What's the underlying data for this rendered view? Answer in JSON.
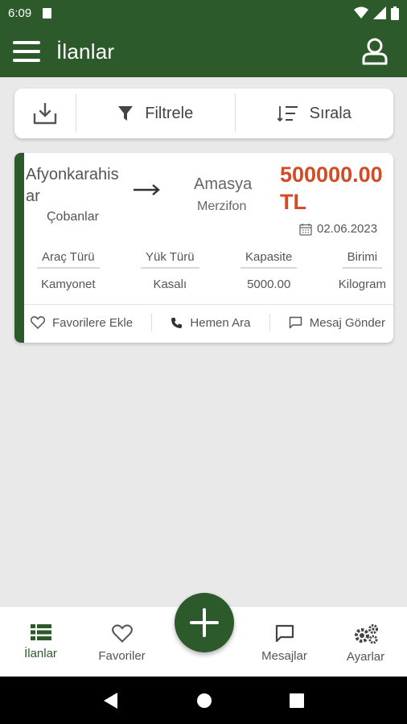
{
  "status_bar": {
    "time": "6:09"
  },
  "app_bar": {
    "title": "İlanlar"
  },
  "toolbar": {
    "filter_label": "Filtrele",
    "sort_label": "Sırala"
  },
  "listing": {
    "origin_city": "Afyonkarahisar",
    "origin_district": "Çobanlar",
    "destination_city": "Amasya",
    "destination_district": "Merzifon",
    "price": "500000.00 TL",
    "date": "02.06.2023",
    "specs": [
      {
        "label": "Araç Türü",
        "value": "Kamyonet"
      },
      {
        "label": "Yük Türü",
        "value": "Kasalı"
      },
      {
        "label": "Kapasite",
        "value": "5000.00"
      },
      {
        "label": "Birimi",
        "value": "Kilogram"
      }
    ],
    "actions": {
      "favorite": "Favorilere Ekle",
      "call": "Hemen Ara",
      "message": "Mesaj Gönder"
    }
  },
  "bottom_nav": {
    "listings": "İlanlar",
    "favorites": "Favoriler",
    "messages": "Mesajlar",
    "settings": "Ayarlar"
  },
  "colors": {
    "primary": "#2d5a2b",
    "price": "#d34a24",
    "background": "#e9e9e9"
  }
}
